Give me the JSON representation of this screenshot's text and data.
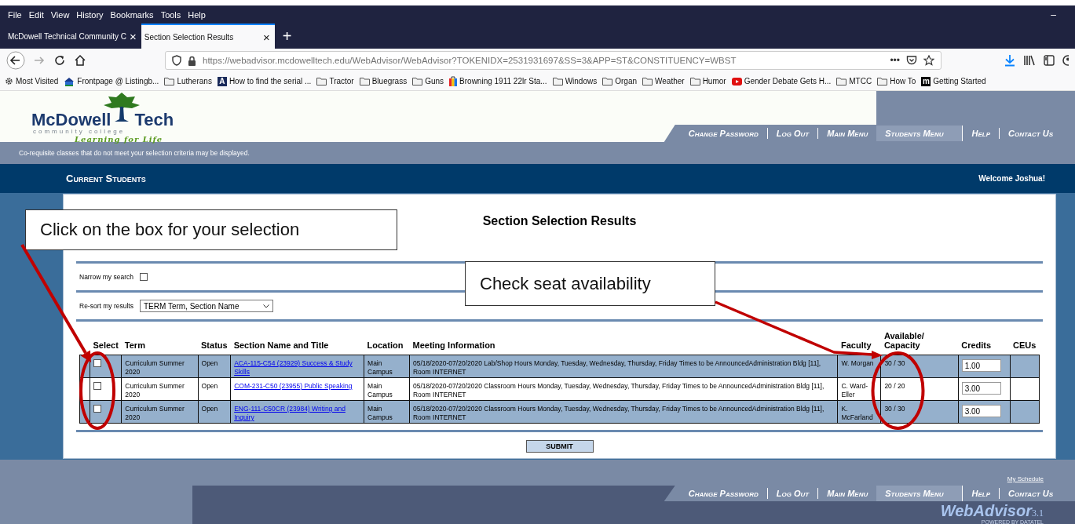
{
  "browser": {
    "menu": [
      "File",
      "Edit",
      "View",
      "History",
      "Bookmarks",
      "Tools",
      "Help"
    ],
    "window_control": "–",
    "tabs": [
      {
        "title": "McDowell Technical Community C",
        "close": "×",
        "selected": false
      },
      {
        "title": "Section Selection Results",
        "close": "×",
        "selected": true
      }
    ],
    "new_tab": "+",
    "url": "https://webadvisor.mcdowelltech.edu/WebAdvisor/WebAdvisor?TOKENIDX=2531931697&SS=3&APP=ST&CONSTITUENCY=WBST",
    "page_actions": "•••",
    "bookmarks": [
      {
        "label": "Most Visited",
        "kind": "gear"
      },
      {
        "label": "Frontpage @ Listingb...",
        "kind": "site"
      },
      {
        "label": "Lutherans",
        "kind": "folder"
      },
      {
        "label": "How to find the serial ...",
        "kind": "letter",
        "icon_letter": "A"
      },
      {
        "label": "Tractor",
        "kind": "folder"
      },
      {
        "label": "Bluegrass",
        "kind": "folder"
      },
      {
        "label": "Guns",
        "kind": "folder"
      },
      {
        "label": "Browning 1911 22lr Sta...",
        "kind": "bag"
      },
      {
        "label": "Windows",
        "kind": "folder"
      },
      {
        "label": "Organ",
        "kind": "folder"
      },
      {
        "label": "Weather",
        "kind": "folder"
      },
      {
        "label": "Humor",
        "kind": "folder"
      },
      {
        "label": "Gender Debate Gets H...",
        "kind": "video"
      },
      {
        "label": "MTCC",
        "kind": "folder"
      },
      {
        "label": "How To",
        "kind": "folder"
      },
      {
        "label": "Getting Started",
        "kind": "letter",
        "icon_letter": "m"
      }
    ]
  },
  "site": {
    "logo": {
      "name_left": "McDowell",
      "name_right": "Tech",
      "subtitle": "community college",
      "tagline": "Learning for Life"
    },
    "nav": [
      {
        "label": "Change Password",
        "selected": false
      },
      {
        "label": "Log Out",
        "selected": false
      },
      {
        "label": "Main Menu",
        "selected": false
      },
      {
        "label": "Students Menu",
        "selected": true
      },
      {
        "label": "Help",
        "selected": false
      },
      {
        "label": "Contact Us",
        "selected": false
      }
    ],
    "notice": "Co-requisite classes that do not meet your selection criteria may be displayed.",
    "section_title": "Current Students",
    "welcome": "Welcome Joshua!",
    "page_title": "Section Selection Results",
    "narrow_search": {
      "label": "Narrow my search",
      "checked": false
    },
    "resort": {
      "label": "Re-sort my results",
      "value": "TERM Term, Section Name"
    },
    "table": {
      "columns": [
        "Select",
        "Term",
        "Status",
        "Section Name and Title",
        "Location",
        "Meeting Information",
        "Faculty",
        "Available/ Capacity",
        "Credits",
        "CEUs"
      ],
      "rows": [
        {
          "checked": false,
          "term": "Curriculum Summer 2020",
          "status": "Open",
          "section": "ACA-115-C54 (23929) Success & Study Skills",
          "location": "Main Campus",
          "meeting": "05/18/2020-07/20/2020 Lab/Shop Hours Monday, Tuesday, Wednesday, Thursday, Friday Times to be AnnouncedAdministration Bldg [11], Room INTERNET",
          "faculty": "W. Morgan",
          "seats": "30 / 30",
          "credits": "1.00"
        },
        {
          "checked": false,
          "term": "Curriculum Summer 2020",
          "status": "Open",
          "section": "COM-231-C50 (23955) Public Speaking",
          "location": "Main Campus",
          "meeting": "05/18/2020-07/20/2020 Classroom Hours Monday, Tuesday, Wednesday, Thursday, Friday Times to be AnnouncedAdministration Bldg [11], Room INTERNET",
          "faculty": "C. Ward-Eller",
          "seats": "20 / 20",
          "credits": "3.00"
        },
        {
          "checked": false,
          "term": "Curriculum Summer 2020",
          "status": "Open",
          "section": "ENG-111-C50CR (23984) Writing and Inquiry",
          "location": "Main Campus",
          "meeting": "05/18/2020-07/20/2020 Classroom Hours Monday, Tuesday, Wednesday, Thursday, Friday Times to be AnnouncedAdministration Bldg [11], Room INTERNET",
          "faculty": "K. McFarland",
          "seats": "30 / 30",
          "credits": "3.00"
        }
      ]
    },
    "submit": "SUBMIT",
    "footer": {
      "link": "My Schedule",
      "nav": [
        {
          "label": "Change Password",
          "selected": false
        },
        {
          "label": "Log Out",
          "selected": false
        },
        {
          "label": "Main Menu",
          "selected": false
        },
        {
          "label": "Students Menu",
          "selected": true
        },
        {
          "label": "Help",
          "selected": false
        },
        {
          "label": "Contact Us",
          "selected": false
        }
      ],
      "brand": "WebAdvisor",
      "version": "3.1",
      "powered": "POWERED BY DATATEL"
    }
  },
  "annotations": [
    {
      "text": "Click on the box for your selection"
    },
    {
      "text": "Check seat availability"
    }
  ]
}
